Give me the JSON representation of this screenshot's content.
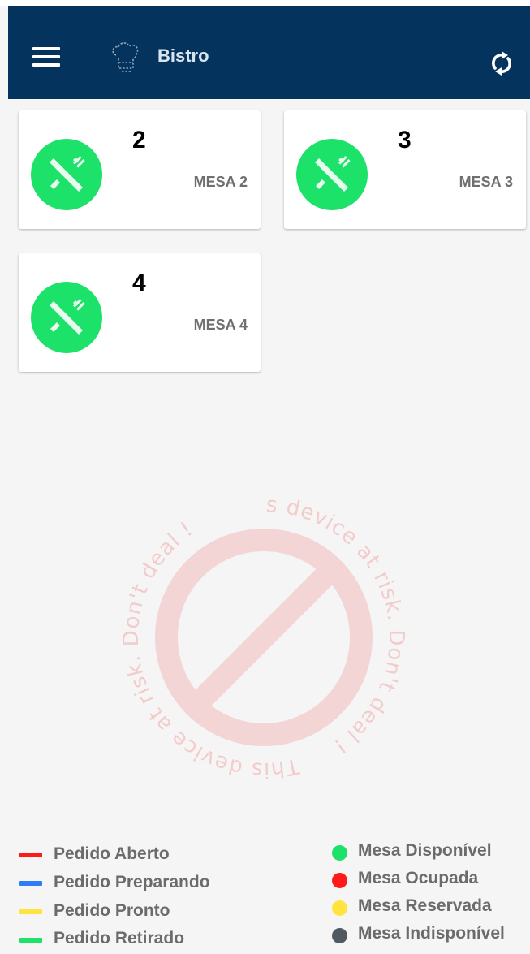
{
  "appbar": {
    "title": "Bistro",
    "background": "#04345e",
    "menu_icon": "hamburger-menu-icon",
    "logo_icon": "chef-hat-logo",
    "refresh_icon": "refresh-icon"
  },
  "tables": [
    {
      "number": "2",
      "name": "MESA 2",
      "status": "disponivel",
      "icon": "fork-knife-icon"
    },
    {
      "number": "3",
      "name": "MESA 3",
      "status": "disponivel",
      "icon": "fork-knife-icon"
    },
    {
      "number": "4",
      "name": "MESA 4",
      "status": "disponivel",
      "icon": "fork-knife-icon"
    }
  ],
  "watermark": {
    "text": "This device at risk. Don't deal !",
    "color": "#f08080"
  },
  "legend": {
    "orders": [
      {
        "label": "Pedido Aberto",
        "color": "#ff1a1a"
      },
      {
        "label": "Pedido Preparando",
        "color": "#2f7df6"
      },
      {
        "label": "Pedido Pronto",
        "color": "#ffe440"
      },
      {
        "label": "Pedido Retirado",
        "color": "#1de26a"
      }
    ],
    "tables": [
      {
        "label": "Mesa Disponível",
        "color": "#1de26a"
      },
      {
        "label": "Mesa Ocupada",
        "color": "#ff1a1a"
      },
      {
        "label": "Mesa Reservada",
        "color": "#ffe440"
      },
      {
        "label": "Mesa Indisponível",
        "color": "#515a61"
      }
    ]
  },
  "colors": {
    "available": "#1de26a",
    "card_label": "#6f6f6f",
    "legend_text": "#6b6b6b"
  }
}
